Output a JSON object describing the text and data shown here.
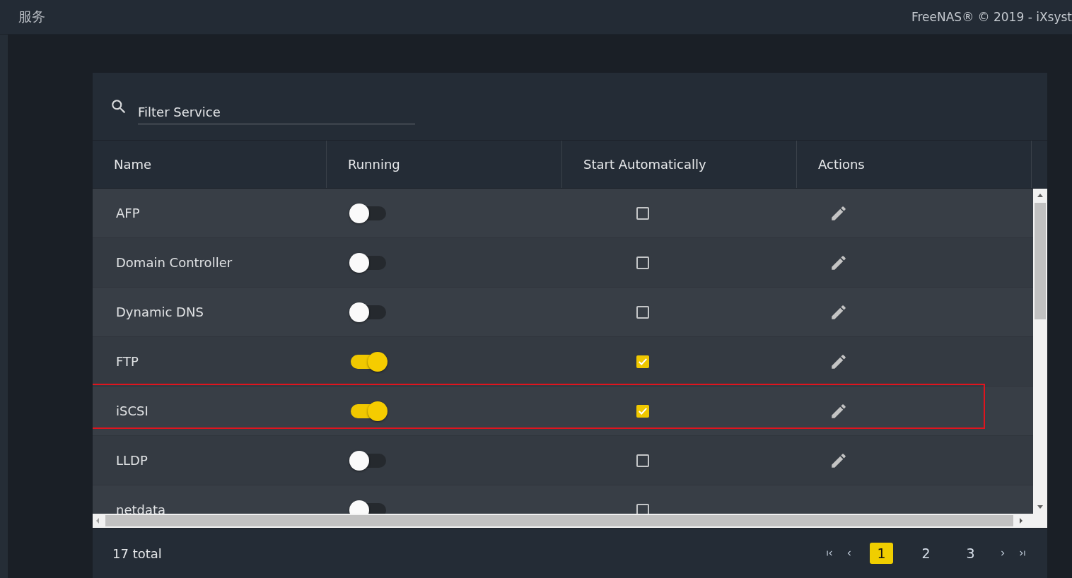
{
  "topbar": {
    "title": "服务",
    "copyright": "FreeNAS® © 2019 - iXsyst"
  },
  "search": {
    "placeholder": "Filter Service"
  },
  "table": {
    "columns": [
      "Name",
      "Running",
      "Start Automatically",
      "Actions"
    ],
    "rows": [
      {
        "name": "AFP",
        "running": false,
        "start_automatically": false,
        "editable": true,
        "annotated": false
      },
      {
        "name": "Domain Controller",
        "running": false,
        "start_automatically": false,
        "editable": true,
        "annotated": false
      },
      {
        "name": "Dynamic DNS",
        "running": false,
        "start_automatically": false,
        "editable": true,
        "annotated": false
      },
      {
        "name": "FTP",
        "running": true,
        "start_automatically": true,
        "editable": true,
        "annotated": false
      },
      {
        "name": "iSCSI",
        "running": true,
        "start_automatically": true,
        "editable": true,
        "annotated": true
      },
      {
        "name": "LLDP",
        "running": false,
        "start_automatically": false,
        "editable": true,
        "annotated": false
      },
      {
        "name": "netdata",
        "running": false,
        "start_automatically": false,
        "editable": false,
        "annotated": false
      }
    ]
  },
  "footer": {
    "total": "17 total",
    "pages": [
      {
        "label": "1",
        "selected": true
      },
      {
        "label": "2",
        "selected": false
      },
      {
        "label": "3",
        "selected": false
      }
    ]
  }
}
